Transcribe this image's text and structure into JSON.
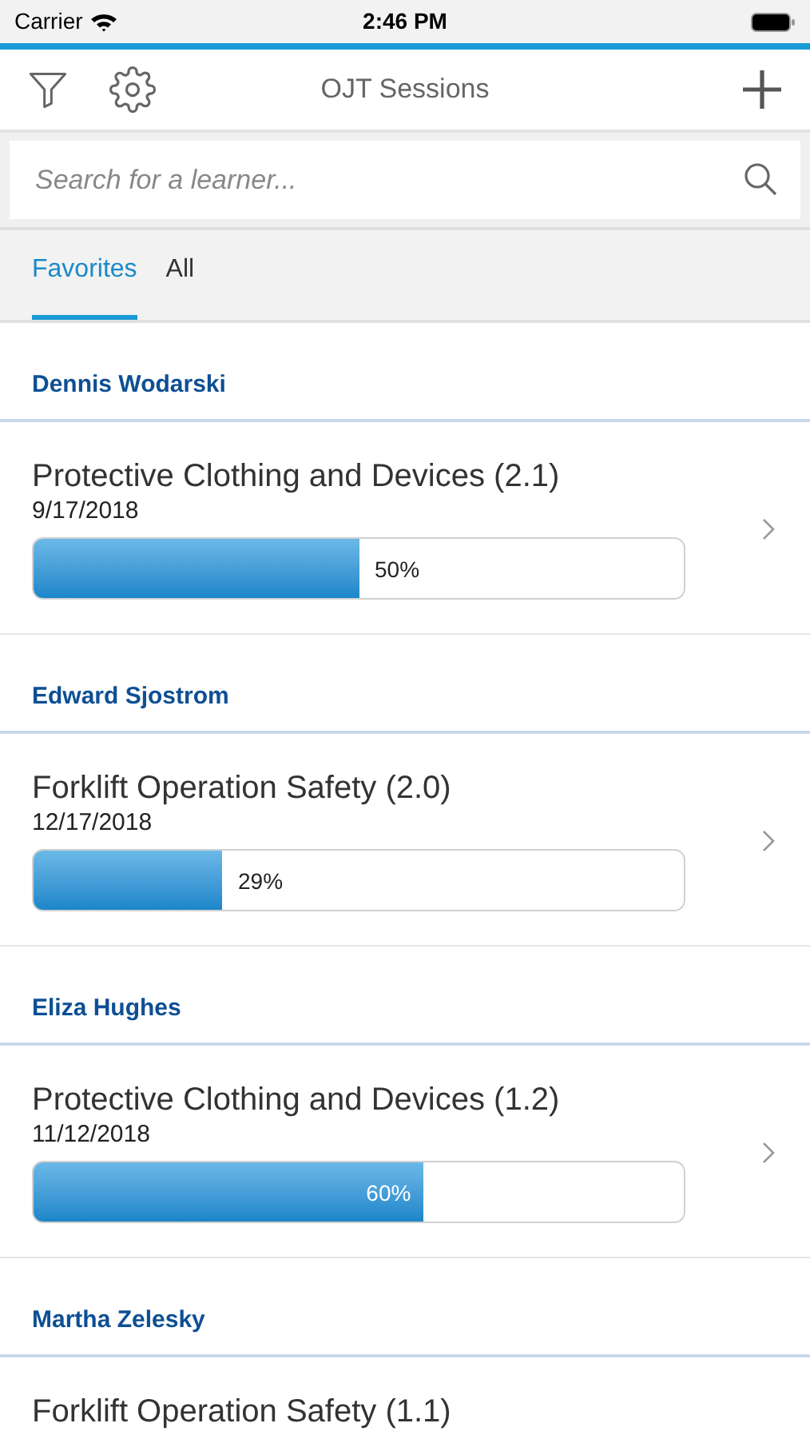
{
  "status_bar": {
    "carrier": "Carrier",
    "time": "2:46 PM"
  },
  "header": {
    "title": "OJT Sessions"
  },
  "search": {
    "placeholder": "Search for a learner..."
  },
  "tabs": [
    {
      "label": "Favorites",
      "selected": true
    },
    {
      "label": "All",
      "selected": false
    }
  ],
  "groups": [
    {
      "learner": "Dennis Wodarski",
      "sessions": [
        {
          "title": "Protective Clothing and Devices (2.1)",
          "date": "9/17/2018",
          "level": 0.5,
          "reading": "50%"
        }
      ]
    },
    {
      "learner": "Edward Sjostrom",
      "sessions": [
        {
          "title": "Forklift Operation Safety (2.0)",
          "date": "12/17/2018",
          "level": 0.29,
          "reading": "29%"
        }
      ]
    },
    {
      "learner": "Eliza Hughes",
      "sessions": [
        {
          "title": "Protective Clothing and Devices (1.2)",
          "date": "11/12/2018",
          "level": 0.6,
          "reading": "60%"
        }
      ]
    },
    {
      "learner": "Martha Zelesky",
      "sessions": [
        {
          "title": "Forklift Operation Safety (1.1)"
        }
      ]
    }
  ]
}
